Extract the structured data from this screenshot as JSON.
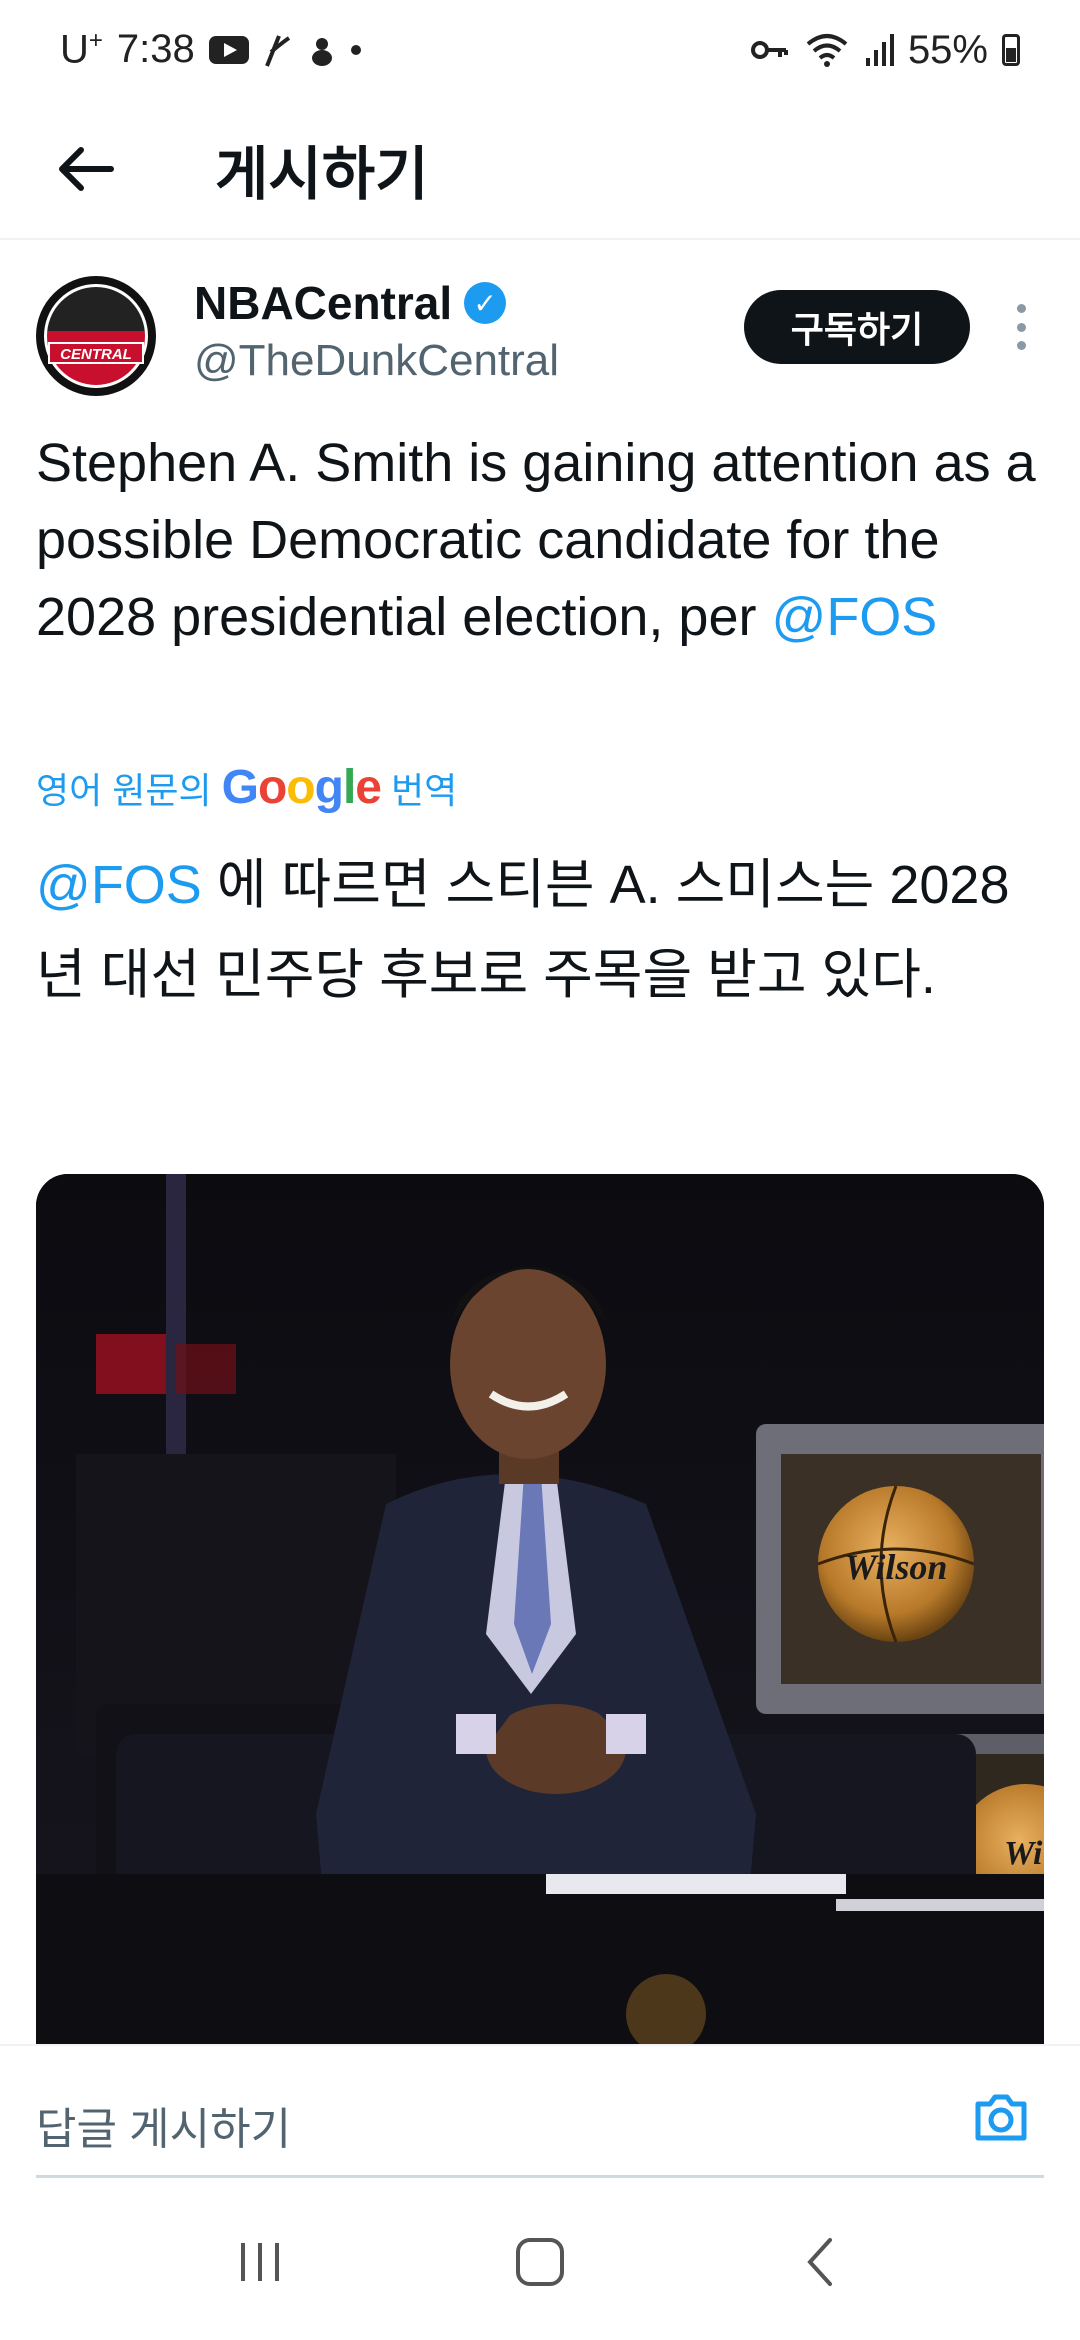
{
  "status_bar": {
    "carrier": "U",
    "carrier_sup": "+",
    "time": "7:38",
    "battery": "55%",
    "icons": [
      "youtube-icon",
      "swoosh-icon",
      "bird-icon",
      "dot-icon",
      "key-icon",
      "wifi-icon",
      "signal-icon",
      "battery-icon"
    ]
  },
  "header": {
    "title": "게시하기"
  },
  "post": {
    "display_name": "NBACentral",
    "handle": "@TheDunkCentral",
    "avatar_text": "CENTRAL",
    "subscribe_label": "구독하기",
    "text_main": "Stephen A. Smith is gaining attention as a possible Democratic candidate for the 2028 presidential election, per ",
    "mention": "@FOS",
    "translate_prefix": "영어 원문의",
    "translate_suffix": "번역",
    "translated_mention": "@FOS",
    "translated_text": " 에 따르면 스티븐 A. 스미스는 2028년 대선 민주당 후보로 주목을 받고 있다.",
    "media_ball_text": "Wilson",
    "media_ball_text2": "Wi"
  },
  "reply": {
    "placeholder": "답글 게시하기"
  },
  "colors": {
    "accent": "#1d9bf0",
    "text": "#0f1419",
    "secondary": "#536471"
  }
}
